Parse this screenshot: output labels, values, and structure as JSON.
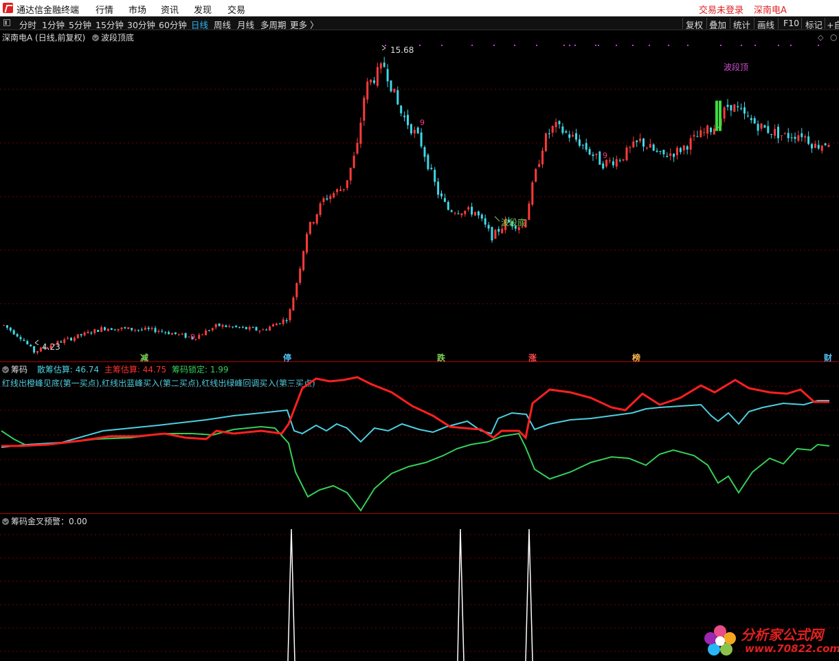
{
  "titlebar": {
    "app_title": "通达信金融终端",
    "menus": [
      "行情",
      "市场",
      "资讯",
      "发现",
      "交易"
    ],
    "login_status": "交易未登录",
    "stock_name": "深南电A"
  },
  "periodbar": {
    "periods": [
      "分时",
      "1分钟",
      "5分钟",
      "15分钟",
      "30分钟",
      "60分钟",
      "日线",
      "周线",
      "月线",
      "多周期",
      "更多 〉"
    ],
    "active": "日线",
    "tools": [
      "复权",
      "叠加",
      "统计",
      "画线",
      "F10",
      "标记",
      "+自"
    ]
  },
  "main_panel": {
    "label": "深南电A (日线,前复权)",
    "indicator": "波段顶底",
    "high_label": "15.68",
    "low_label": "4.23",
    "bottom_label": "波段底",
    "top_label": "波段顶",
    "count_marks": [
      "9",
      "9",
      "9"
    ],
    "signals": [
      {
        "text": "减",
        "color": "#7cd35a"
      },
      {
        "text": "停",
        "color": "#4fc3f7"
      },
      {
        "text": "跌",
        "color": "#7cd35a"
      },
      {
        "text": "涨",
        "color": "#ff4d4d"
      },
      {
        "text": "榜",
        "color": "#ffb74d"
      },
      {
        "text": "财",
        "color": "#4fc3f7"
      }
    ]
  },
  "chip_panel": {
    "name": "筹码",
    "retail_label": "散筹估算:",
    "retail_value": "46.74",
    "main_label": "主筹估算:",
    "main_value": "44.75",
    "lock_label": "筹码锁定:",
    "lock_value": "1.99",
    "description": "红线出橙峰见底(第一买点),红线出蓝峰买入(第二买点),红线出绿峰回调买入(第三买点)",
    "colors": {
      "retail": "#4dd0e1",
      "main": "#ff3030",
      "lock": "#34d058"
    }
  },
  "warn_panel": {
    "name": "筹码金叉预警",
    "value": "0.00"
  },
  "watermark": {
    "title": "分析家公式网",
    "url": "www.70822.com"
  },
  "colors": {
    "up": "#ff3b3b",
    "down": "#3fd8e8",
    "grid": "#7a0000",
    "active_tab": "#29b6f6"
  }
}
